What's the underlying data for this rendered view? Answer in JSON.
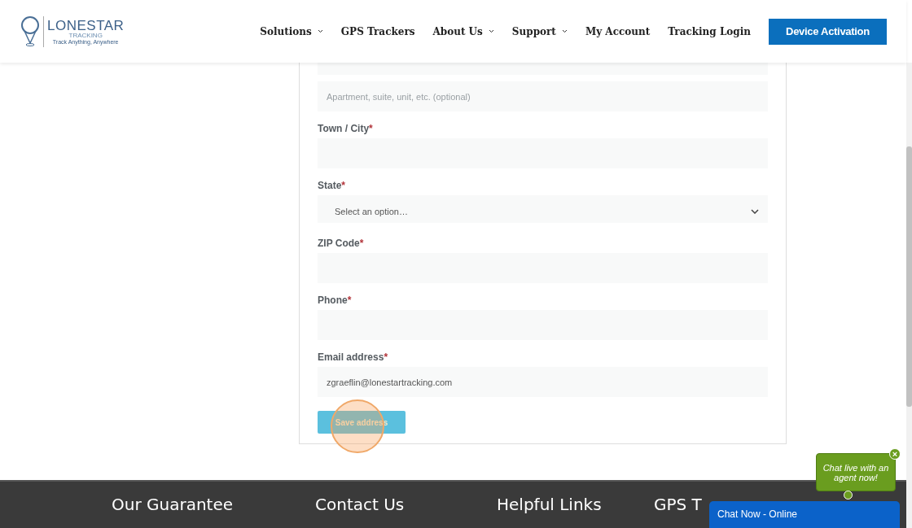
{
  "header": {
    "logo": {
      "name": "LONESTAR",
      "sub": "TRACKING",
      "tagline": "Track Anything, Anywhere"
    },
    "nav": [
      {
        "label": "Solutions",
        "has_dropdown": true
      },
      {
        "label": "GPS Trackers",
        "has_dropdown": false
      },
      {
        "label": "About Us",
        "has_dropdown": true
      },
      {
        "label": "Support",
        "has_dropdown": true
      },
      {
        "label": "My Account",
        "has_dropdown": false
      },
      {
        "label": "Tracking Login",
        "has_dropdown": false
      }
    ],
    "cta": "Device Activation"
  },
  "form": {
    "fields": [
      {
        "kind": "partial"
      },
      {
        "kind": "text",
        "placeholder": "Apartment, suite, unit, etc. (optional)"
      },
      {
        "kind": "text",
        "label": "Town / City",
        "required_mark": "*"
      },
      {
        "kind": "select",
        "label": "State",
        "required_mark": "*",
        "value": "Select an option…"
      },
      {
        "kind": "text",
        "label": "ZIP Code",
        "required_mark": "*"
      },
      {
        "kind": "text",
        "label": "Phone",
        "required_mark": "*"
      },
      {
        "kind": "text",
        "label": "Email address",
        "required_mark": "*",
        "value": "zgraeflin@lonestartracking.com"
      }
    ],
    "submit": "Save address"
  },
  "footer": {
    "headings": [
      [
        "Our Guarantee"
      ],
      [
        "Contact Us"
      ],
      [
        "Helpful Links"
      ],
      [
        "GPS T"
      ]
    ]
  },
  "chat": {
    "bubble": "Chat live with an agent now!",
    "close": "×",
    "bar": "Chat Now - Online"
  }
}
